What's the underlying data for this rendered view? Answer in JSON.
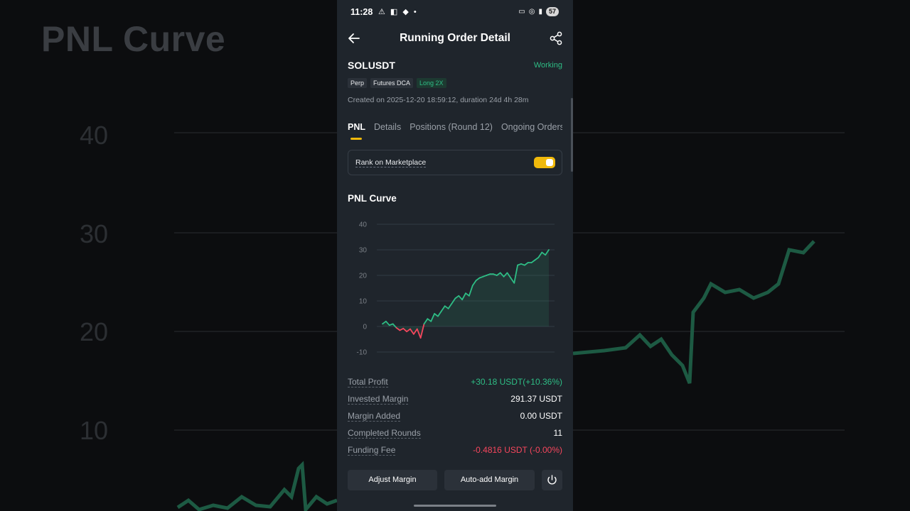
{
  "background": {
    "title": "PNL Curve",
    "ticks": [
      "40",
      "30",
      "20",
      "10"
    ]
  },
  "status_bar": {
    "time": "11:28",
    "battery": "57"
  },
  "header": {
    "title": "Running Order Detail"
  },
  "order": {
    "symbol": "SOLUSDT",
    "status": "Working",
    "tags": [
      "Perp",
      "Futures DCA",
      "Long 2X"
    ],
    "created": "Created on 2025-12-20 18:59:12, duration 24d 4h 28m"
  },
  "tabs": [
    {
      "label": "PNL",
      "active": true
    },
    {
      "label": "Details",
      "active": false
    },
    {
      "label": "Positions (Round 12)",
      "active": false
    },
    {
      "label": "Ongoing Orders",
      "active": false
    }
  ],
  "rank": {
    "label": "Rank on Marketplace",
    "enabled": true
  },
  "pnl_section_title": "PNL Curve",
  "chart_data": {
    "type": "area",
    "title": "",
    "xlabel": "",
    "ylabel": "",
    "ylim": [
      -10,
      40
    ],
    "yticks": [
      40,
      30,
      20,
      10,
      0,
      -10
    ],
    "grid": true,
    "colors": {
      "positive": "#2ebd85",
      "negative": "#f6465d"
    },
    "values": [
      1,
      2,
      0.5,
      1,
      -0.5,
      -1.5,
      -0.8,
      -2,
      -1,
      -3,
      -1,
      -4.5,
      1,
      3,
      2,
      5,
      4,
      6,
      8,
      7,
      9,
      11,
      12,
      10.5,
      13,
      12,
      16,
      18,
      19,
      19.5,
      20,
      20.5,
      20.5,
      20,
      21,
      19.5,
      21,
      19,
      17,
      24,
      24.5,
      24,
      25,
      25,
      26,
      27,
      29,
      28,
      30
    ]
  },
  "stats": [
    {
      "label": "Total Profit",
      "value": "+30.18 USDT(+10.36%)",
      "color": "green"
    },
    {
      "label": "Invested Margin",
      "value": "291.37 USDT",
      "color": "white"
    },
    {
      "label": "Margin Added",
      "value": "0.00 USDT",
      "color": "white"
    },
    {
      "label": "Completed Rounds",
      "value": "11",
      "color": "white"
    },
    {
      "label": "Funding Fee",
      "value": "-0.4816 USDT (-0.00%)",
      "color": "red"
    }
  ],
  "buttons": {
    "adjust_margin": "Adjust Margin",
    "auto_add_margin": "Auto-add Margin"
  }
}
